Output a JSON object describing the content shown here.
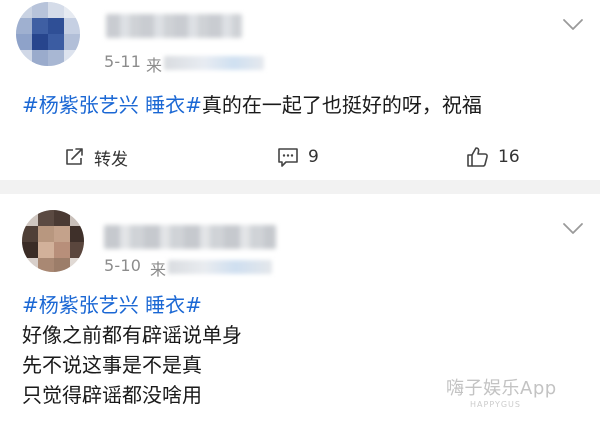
{
  "posts": [
    {
      "date": "5-11",
      "source_prefix": "来",
      "content": [
        {
          "parts": [
            {
              "text": "#杨紫张艺兴 睡衣#",
              "tag": true
            },
            {
              "text": "真的在一起了也挺好的呀，祝福",
              "tag": false
            }
          ]
        }
      ],
      "actions": {
        "repost_label": "转发",
        "comment_count": "9",
        "like_count": "16"
      }
    },
    {
      "date": "5-10",
      "source_prefix": "来",
      "content": [
        {
          "parts": [
            {
              "text": "#杨紫张艺兴 睡衣#",
              "tag": true
            }
          ]
        },
        {
          "parts": [
            {
              "text": "好像之前都有辟谣说单身",
              "tag": false
            }
          ]
        },
        {
          "parts": [
            {
              "text": "先不说这事是不是真",
              "tag": false
            }
          ]
        },
        {
          "parts": [
            {
              "text": "只觉得辟谣都没啥用",
              "tag": false
            }
          ]
        }
      ]
    }
  ],
  "watermark": {
    "text": "嗨子娱乐App",
    "sub": "HAPPYGUS"
  },
  "colors": {
    "topic_link": "#1a67d4",
    "date_text": "#8c8c8c",
    "divider": "#f2f2f2"
  },
  "icons": {
    "repost": "share-square-icon",
    "comment": "comment-bubble-icon",
    "like": "thumbs-up-icon",
    "menu": "chevron-down-icon"
  }
}
